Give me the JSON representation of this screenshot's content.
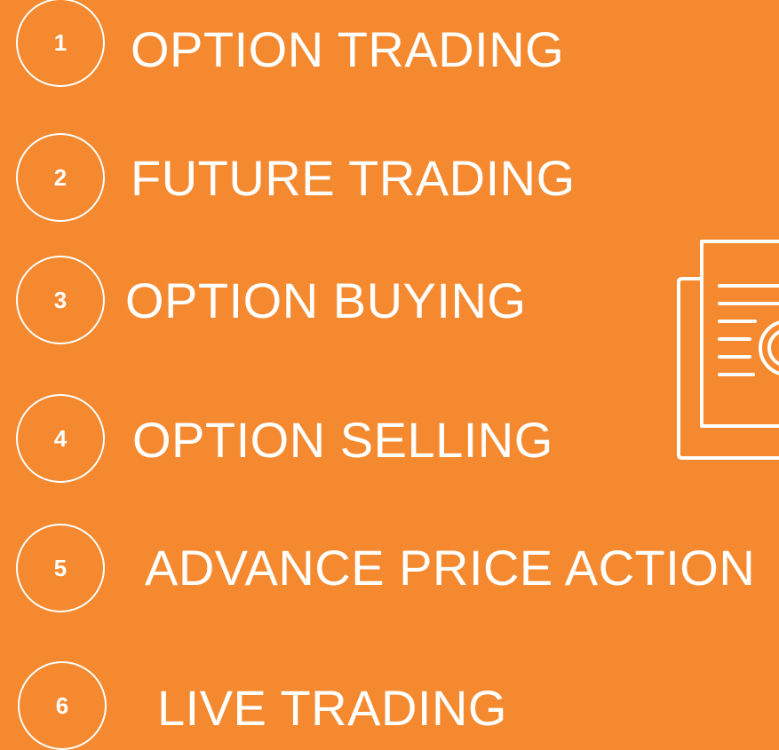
{
  "background_color": "#F5892F",
  "text_color": "#FFFFFF",
  "items": [
    {
      "number": "1",
      "label": "OPTION TRADING"
    },
    {
      "number": "2",
      "label": "FUTURE TRADING"
    },
    {
      "number": "3",
      "label": "OPTION BUYING"
    },
    {
      "number": "4",
      "label": "OPTION SELLING"
    },
    {
      "number": "5",
      "label": "ADVANCE PRICE ACTION"
    },
    {
      "number": "6",
      "label": "LIVE TRADING"
    }
  ],
  "icon": "document-with-magnifier-icon"
}
